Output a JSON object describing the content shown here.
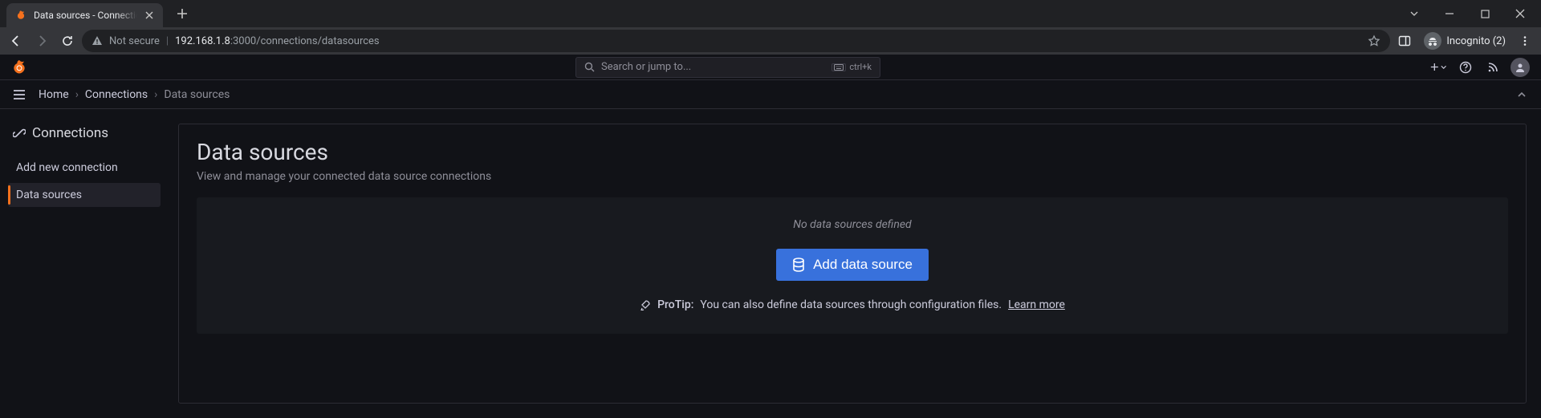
{
  "browser": {
    "tab_title": "Data sources - Connections - Grafana",
    "not_secure_label": "Not secure",
    "url_host": "192.168.1.8",
    "url_port_path": ":3000/connections/datasources",
    "incognito_label": "Incognito (2)"
  },
  "grafana": {
    "search_placeholder": "Search or jump to...",
    "search_shortcut": "ctrl+k",
    "breadcrumbs": {
      "home": "Home",
      "connections": "Connections",
      "current": "Data sources"
    },
    "sidebar": {
      "title": "Connections",
      "items": [
        {
          "label": "Add new connection",
          "active": false
        },
        {
          "label": "Data sources",
          "active": true
        }
      ]
    },
    "page": {
      "title": "Data sources",
      "subtitle": "View and manage your connected data source connections",
      "empty_state": "No data sources defined",
      "add_button": "Add data source",
      "protip_label": "ProTip:",
      "protip_text": "You can also define data sources through configuration files.",
      "learn_more": "Learn more"
    }
  }
}
